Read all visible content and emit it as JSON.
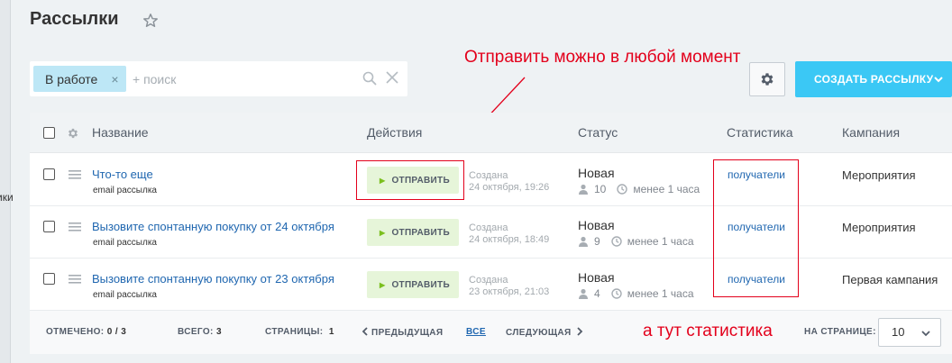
{
  "left_strip": {
    "text": "ики"
  },
  "page": {
    "title": "Рассылки"
  },
  "filter": {
    "chip_label": "В работе",
    "chip_close": "×",
    "search_placeholder": "+ поиск"
  },
  "annotations": {
    "top": "Отправить можно в любой момент",
    "bottom": "а тут статистика"
  },
  "toolbar": {
    "create_label": "СОЗДАТЬ РАССЫЛКУ"
  },
  "grid": {
    "columns": {
      "name": "Название",
      "actions": "Действия",
      "status": "Статус",
      "stats": "Статистика",
      "campaign": "Кампания"
    },
    "rows": [
      {
        "name": "Что-то еще",
        "type": "email рассылка",
        "action_label": "ОТПРАВИТЬ",
        "created_label": "Создана",
        "created_date": "24 октября, 19:26",
        "status": "Новая",
        "recipients": "10",
        "time_ago": "менее 1 часа",
        "stats_link": "получатели",
        "campaign": "Мероприятия"
      },
      {
        "name": "Вызовите спонтанную покупку от 24 октября",
        "type": "email рассылка",
        "action_label": "ОТПРАВИТЬ",
        "created_label": "Создана",
        "created_date": "24 октября, 18:49",
        "status": "Новая",
        "recipients": "9",
        "time_ago": "менее 1 часа",
        "stats_link": "получатели",
        "campaign": "Мероприятия"
      },
      {
        "name": "Вызовите спонтанную покупку от 23 октября",
        "type": "email рассылка",
        "action_label": "ОТПРАВИТЬ",
        "created_label": "Создана",
        "created_date": "23 октября, 21:03",
        "status": "Новая",
        "recipients": "4",
        "time_ago": "менее 1 часа",
        "stats_link": "получатели",
        "campaign": "Первая кампания"
      }
    ]
  },
  "footer": {
    "selected_label": "ОТМЕЧЕНО:",
    "selected_value": "0 / 3",
    "total_label": "ВСЕГО:",
    "total_value": "3",
    "pages_label": "СТРАНИЦЫ:",
    "pages_value": "1",
    "prev_label": "ПРЕДЫДУЩАЯ",
    "all_label": "ВСЕ",
    "next_label": "СЛЕДУЮЩАЯ",
    "per_page_label": "НА СТРАНИЦЕ:",
    "per_page_value": "10"
  },
  "colors": {
    "accent": "#3bc8f5",
    "link": "#2067b0",
    "annotation": "#e3001b",
    "send_bg": "#e6f5d9",
    "chip_bg": "#bde7f6"
  },
  "icons": [
    "star-icon",
    "search-icon",
    "close-icon",
    "gear-icon",
    "chevron-down-icon",
    "drag-handle-icon",
    "play-icon",
    "person-icon",
    "clock-icon",
    "chevron-left-icon",
    "chevron-right-icon"
  ]
}
